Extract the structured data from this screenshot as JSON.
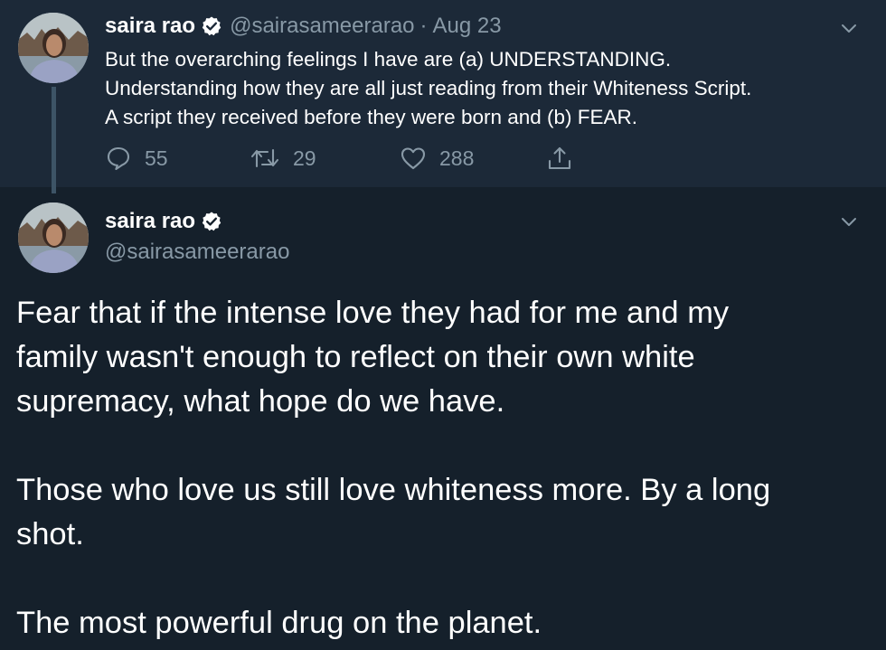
{
  "parent_tweet": {
    "name": "saira rao",
    "handle": "@sairasameerarao",
    "separator": "·",
    "date": "Aug 23",
    "text_lines": [
      "But the overarching feelings I have are (a) UNDERSTANDING.",
      "Understanding how they are all just reading from their Whiteness Script.",
      "A script they received before they were born and (b) FEAR."
    ],
    "replies": "55",
    "retweets": "29",
    "likes": "288"
  },
  "main_tweet": {
    "name": "saira rao",
    "handle": "@sairasameerarao",
    "paragraphs": [
      [
        "Fear that if the intense love they had for me and my",
        "family wasn't enough to reflect on their own white",
        "supremacy, what hope do we have."
      ],
      [
        "Those who love us still love whiteness more. By a long",
        "shot."
      ],
      [
        "The most powerful drug on the planet."
      ]
    ]
  },
  "icons": {
    "verified": "verified-badge-icon",
    "more": "chevron-down-icon",
    "reply": "reply-icon",
    "retweet": "retweet-icon",
    "like": "heart-icon",
    "share": "share-icon"
  },
  "colors": {
    "background": "#15202b",
    "parent_background": "#1c2938",
    "thread_line": "#3d5466",
    "primary_text": "#ffffff",
    "secondary_text": "#8899a6"
  }
}
